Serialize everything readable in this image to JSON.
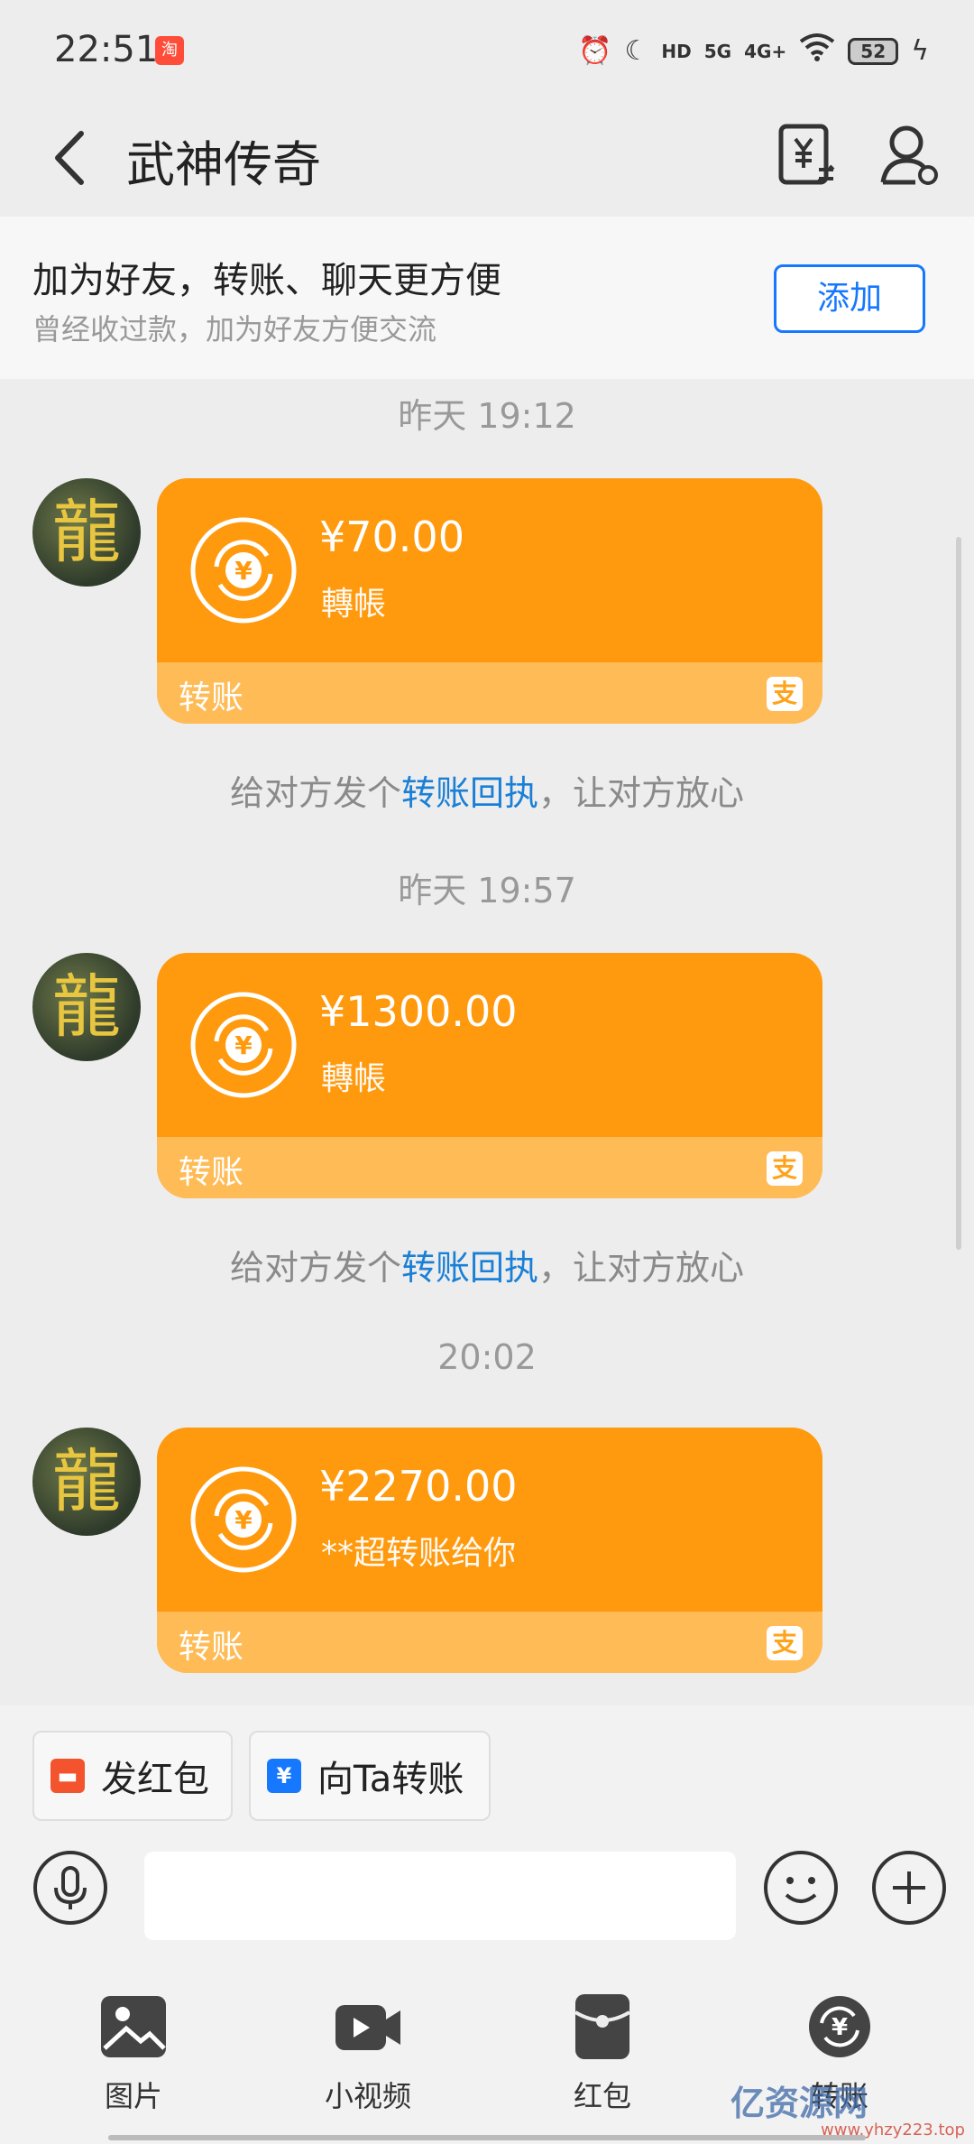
{
  "status_bar": {
    "time": "22:51",
    "battery": "52",
    "network_1": "HD",
    "network_2": "5G",
    "network_3": "4G+",
    "icons": [
      "alarm-icon",
      "moon-icon",
      "signal-icon",
      "wifi-icon",
      "battery-icon",
      "charging-icon"
    ]
  },
  "header": {
    "title": "武神传奇",
    "icons": [
      "back-icon",
      "transfer-record-icon",
      "profile-icon"
    ]
  },
  "banner": {
    "title": "加为好友，转账、聊天更方便",
    "subtitle": "曾经收过款，加为好友方便交流",
    "add_label": "添加"
  },
  "messages": [
    {
      "timestamp": "昨天 19:12",
      "amount": "¥70.00",
      "note": "轉帳",
      "footer": "转账"
    },
    {
      "timestamp": "昨天 19:57",
      "amount": "¥1300.00",
      "note": "轉帳",
      "footer": "转账"
    },
    {
      "timestamp": "20:02",
      "amount": "¥2270.00",
      "note": "**超转账给你",
      "footer": "转账"
    }
  ],
  "receipt_hint": {
    "prefix": "给对方发个",
    "link": "转账回执",
    "suffix": "，让对方放心"
  },
  "quick_actions": {
    "red_packet": "发红包",
    "transfer": "向Ta转账"
  },
  "composer": {
    "placeholder": ""
  },
  "tools": [
    {
      "label": "图片",
      "icon": "image-icon"
    },
    {
      "label": "小视频",
      "icon": "video-icon"
    },
    {
      "label": "红包",
      "icon": "red-packet-icon"
    },
    {
      "label": "转账",
      "icon": "transfer-icon"
    }
  ],
  "watermark": {
    "text": "亿资源网",
    "url": "www.yhzy223.top"
  },
  "colors": {
    "card_orange": "#ff9a0e",
    "card_footer": "#ffbb55",
    "link_blue": "#1a7fd6",
    "add_blue": "#1677ff"
  }
}
